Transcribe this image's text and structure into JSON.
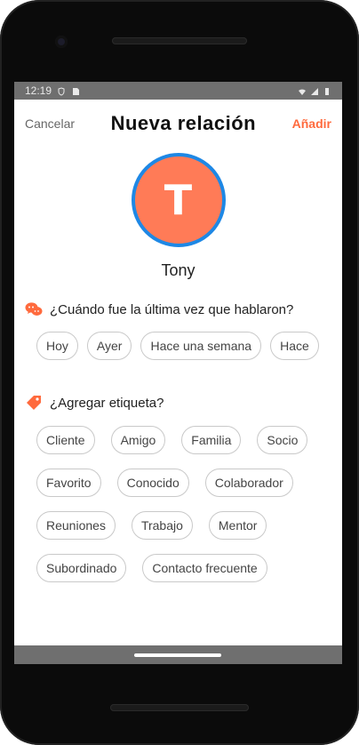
{
  "status": {
    "time": "12:19"
  },
  "header": {
    "cancel": "Cancelar",
    "title": "Nueva relación",
    "add": "Añadir"
  },
  "contact": {
    "initial": "T",
    "name": "Tony",
    "avatar_color": "#ff7b57",
    "avatar_ring_color": "#1e88e5"
  },
  "last_talk": {
    "question": "¿Cuándo fue la última vez que hablaron?",
    "icon": "chat-icon",
    "options": [
      "Hoy",
      "Ayer",
      "Hace una semana",
      "Hace"
    ]
  },
  "tags": {
    "question": "¿Agregar etiqueta?",
    "icon": "tag-icon",
    "rows": [
      [
        "Cliente",
        "Amigo",
        "Familia",
        "Socio"
      ],
      [
        "Favorito",
        "Conocido",
        "Colaborador"
      ],
      [
        "Reuniones",
        "Trabajo",
        "Mentor"
      ],
      [
        "Subordinado",
        "Contacto frecuente"
      ]
    ]
  },
  "colors": {
    "accent": "#ff6a3d",
    "chip_border": "#c9c9c9"
  }
}
